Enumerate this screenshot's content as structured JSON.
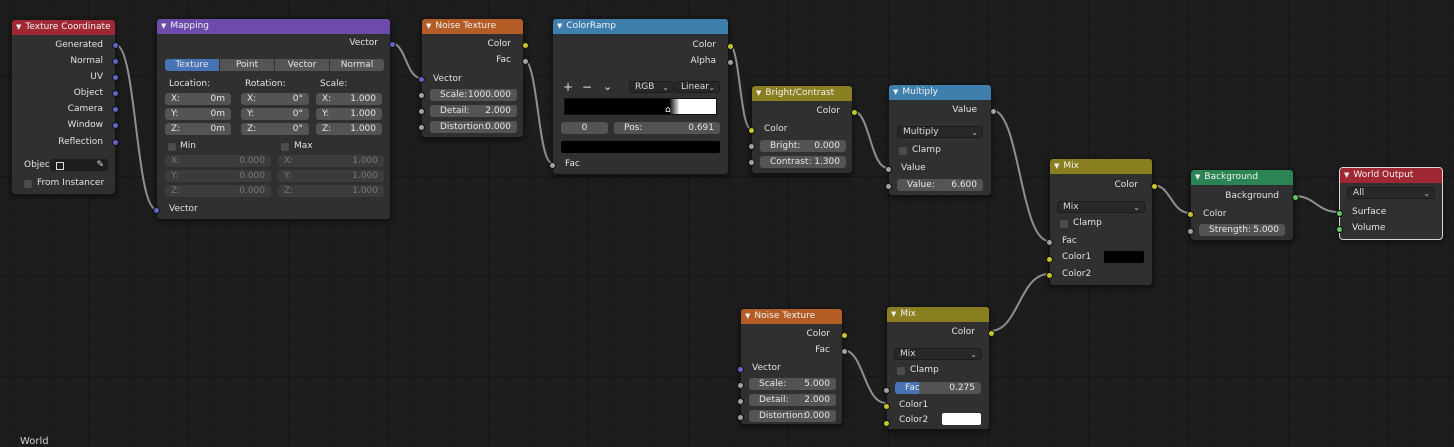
{
  "nodes": {
    "tex_coord": {
      "title": "Texture Coordinate",
      "outputs": [
        "Generated",
        "Normal",
        "UV",
        "Object",
        "Camera",
        "Window",
        "Reflection"
      ],
      "object_label": "Objec",
      "from_instancer": "From Instancer"
    },
    "mapping": {
      "title": "Mapping",
      "output": "Vector",
      "tabs": [
        "Texture",
        "Point",
        "Vector",
        "Normal"
      ],
      "location_label": "Location:",
      "rotation_label": "Rotation:",
      "scale_label": "Scale:",
      "axes": [
        "X:",
        "Y:",
        "Z:"
      ],
      "location": [
        "0m",
        "0m",
        "0m"
      ],
      "rotation": [
        "0°",
        "0°",
        "0°"
      ],
      "scale": [
        "1.000",
        "1.000",
        "1.000"
      ],
      "min_label": "Min",
      "max_label": "Max",
      "min_values": [
        "0.000",
        "0.000",
        "0.000"
      ],
      "max_values": [
        "1.000",
        "1.000",
        "1.000"
      ],
      "input": "Vector"
    },
    "noise1": {
      "title": "Noise Texture",
      "out_color": "Color",
      "out_fac": "Fac",
      "in_vector": "Vector",
      "scale_label": "Scale:",
      "scale": "1000.000",
      "detail_label": "Detail:",
      "detail": "2.000",
      "distortion_label": "Distortion:",
      "distortion": "0.000"
    },
    "colorramp": {
      "title": "ColorRamp",
      "out_color": "Color",
      "out_alpha": "Alpha",
      "plus": "+",
      "minus": "−",
      "more": "⌄",
      "mode": "RGB",
      "interp": "Linear",
      "index": "0",
      "pos_label": "Pos:",
      "pos": "0.691",
      "in_fac": "Fac"
    },
    "bright": {
      "title": "Bright/Contrast",
      "out_color": "Color",
      "in_color": "Color",
      "bright_label": "Bright:",
      "bright": "0.000",
      "contrast_label": "Contrast:",
      "contrast": "1.300"
    },
    "multiply": {
      "title": "Multiply",
      "out_value": "Value",
      "operation": "Multiply",
      "clamp": "Clamp",
      "in_value": "Value",
      "value_label": "Value:",
      "value": "6.600"
    },
    "mix1": {
      "title": "Mix",
      "out_color": "Color",
      "blend": "Mix",
      "clamp": "Clamp",
      "fac": "Fac",
      "color1": "Color1",
      "color2": "Color2"
    },
    "background": {
      "title": "Background",
      "out": "Background",
      "in_color": "Color",
      "strength_label": "Strength:",
      "strength": "5.000"
    },
    "world_output": {
      "title": "World Output",
      "target": "All",
      "surface": "Surface",
      "volume": "Volume"
    },
    "noise2": {
      "title": "Noise Texture",
      "out_color": "Color",
      "out_fac": "Fac",
      "in_vector": "Vector",
      "scale_label": "Scale:",
      "scale": "5.000",
      "detail_label": "Detail:",
      "detail": "2.000",
      "distortion_label": "Distortion:",
      "distortion": "0.000"
    },
    "mix2": {
      "title": "Mix",
      "out_color": "Color",
      "blend": "Mix",
      "clamp": "Clamp",
      "fac_label": "Fac",
      "fac": "0.275",
      "color1": "Color1",
      "color2": "Color2"
    }
  },
  "footer": "World",
  "colors": {
    "vector_socket": "#6363c7",
    "color_socket": "#c7c729",
    "value_socket": "#a1a1a1",
    "shader_socket": "#63c763",
    "link": "#9a9a9a"
  }
}
